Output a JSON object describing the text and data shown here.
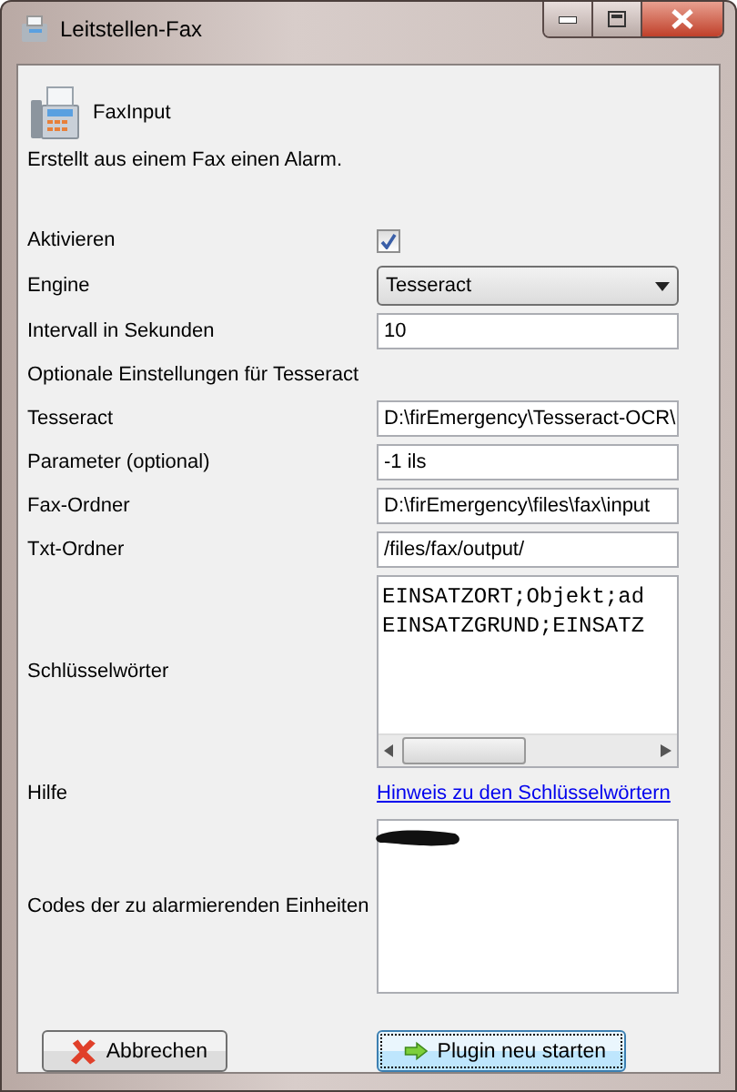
{
  "window": {
    "title": "Leitstellen-Fax"
  },
  "plugin": {
    "name": "FaxInput",
    "description": "Erstellt aus einem Fax einen Alarm."
  },
  "rows": [
    {
      "kind": "checkbox",
      "label": "Aktivieren",
      "checked": true
    },
    {
      "kind": "select",
      "label": "Engine",
      "value": "Tesseract"
    },
    {
      "kind": "text",
      "label": "Intervall in Sekunden",
      "value": "10"
    },
    {
      "kind": "heading",
      "label": "Optionale Einstellungen für Tesseract"
    },
    {
      "kind": "text",
      "label": "Tesseract",
      "value": "D:\\firEmergency\\Tesseract-OCR\\"
    },
    {
      "kind": "text",
      "label": "Parameter (optional)",
      "value": "-1 ils"
    },
    {
      "kind": "text",
      "label": "Fax-Ordner",
      "value": "D:\\firEmergency\\files\\fax\\input"
    },
    {
      "kind": "text",
      "label": "Txt-Ordner",
      "value": "/files/fax/output/"
    },
    {
      "kind": "textarea",
      "label": "Schlüsselwörter",
      "lines": [
        "EINSATZORT;Objekt;ad",
        "EINSATZGRUND;EINSATZ"
      ]
    },
    {
      "kind": "link",
      "label": "Hilfe",
      "value": "Hinweis zu den Schlüsselwörtern"
    },
    {
      "kind": "codes",
      "label": "Codes der zu alarmierenden Einheiten"
    }
  ],
  "buttons": [
    {
      "kind": "cancel",
      "label": "Abbrechen",
      "focused": false
    },
    {
      "kind": "restart",
      "label": "Plugin neu starten",
      "focused": true
    }
  ]
}
